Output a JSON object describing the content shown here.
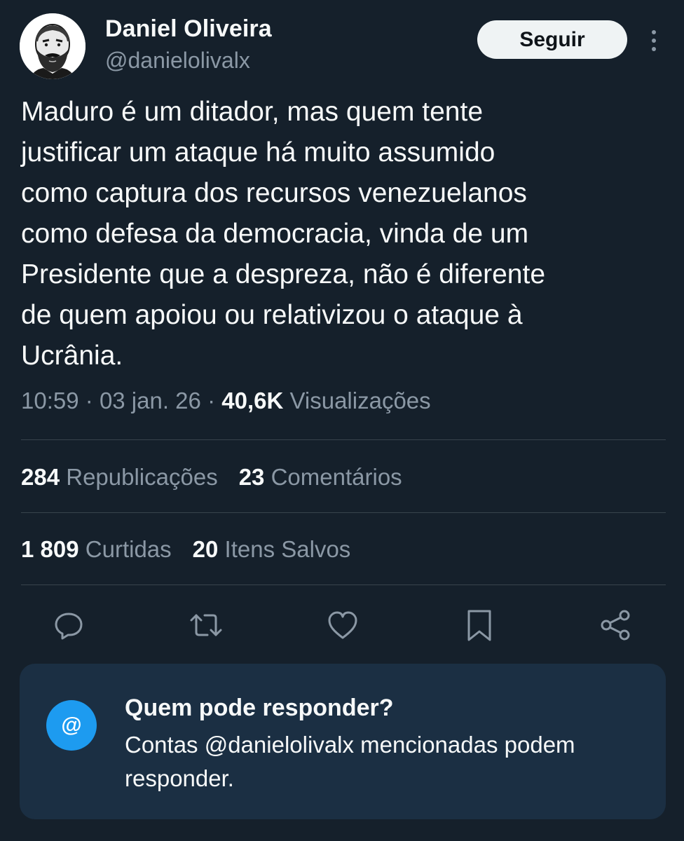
{
  "author": {
    "name": "Daniel Oliveira",
    "handle": "@danielolivalx"
  },
  "follow_button": {
    "label": "Seguir"
  },
  "more_menu": {
    "icon": "more-vertical-icon"
  },
  "tweet": {
    "text": "Maduro é um ditador, mas quem tente\njustificar um ataque há muito assumido\ncomo captura dos recursos venezuelanos\ncomo defesa da democracia, vinda de um\nPresidente que a despreza, não é diferente\nde quem apoiou ou relativizou o ataque à\nUcrânia."
  },
  "meta": {
    "time": "10:59",
    "separator": "·",
    "date": "03 jan. 26",
    "views_count": "40,6K",
    "views_label": "Visualizações"
  },
  "stats": {
    "reposts": {
      "count": "284",
      "label": "Republicações"
    },
    "comments": {
      "count": "23",
      "label": "Comentários"
    },
    "likes": {
      "count": "1 809",
      "label": "Curtidas"
    },
    "saves": {
      "count": "20",
      "label": "Itens Salvos"
    }
  },
  "actions": [
    {
      "name": "reply",
      "icon": "reply-icon"
    },
    {
      "name": "repost",
      "icon": "repost-icon"
    },
    {
      "name": "like",
      "icon": "heart-icon"
    },
    {
      "name": "bookmark",
      "icon": "bookmark-icon"
    },
    {
      "name": "share",
      "icon": "share-icon"
    }
  ],
  "reply_restriction": {
    "icon_text": "@",
    "title": "Quem pode responder?",
    "body": "Contas @danielolivalx mencionadas podem responder."
  },
  "colors": {
    "background": "#15202b",
    "text": "#f7f9f9",
    "secondary_text": "#8b98a5",
    "accent": "#1d9bf0",
    "card_background": "#1b2f43",
    "divider": "#38444d"
  }
}
